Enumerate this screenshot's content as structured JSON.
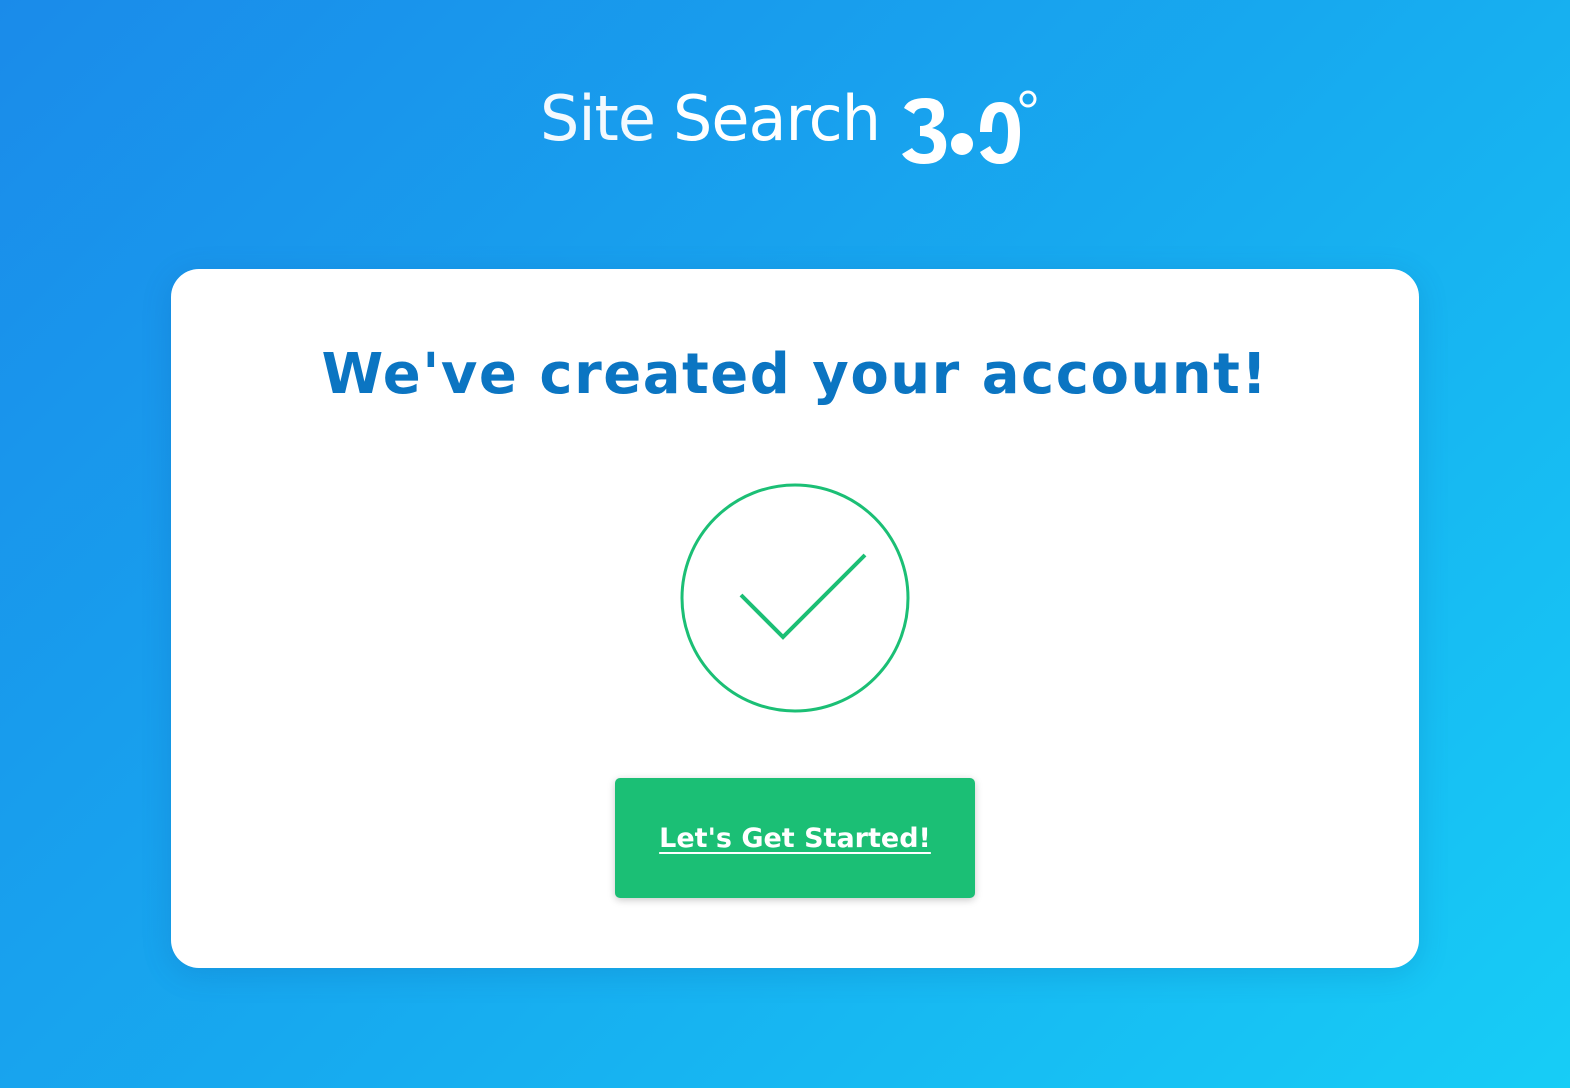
{
  "brand": {
    "logo_text_site": "Site",
    "logo_text_search": "Search",
    "logo_mark": "360°",
    "text_color": "#ffffff",
    "background_gradient": [
      "#1a8bea",
      "#17cdf6"
    ]
  },
  "card": {
    "title": "We've created your account!",
    "title_color": "#0b75c2",
    "status_icon": "check-circle-icon",
    "status_color": "#1bbf75",
    "cta_label": "Let's Get Started!",
    "cta_color": "#1bbf75"
  }
}
